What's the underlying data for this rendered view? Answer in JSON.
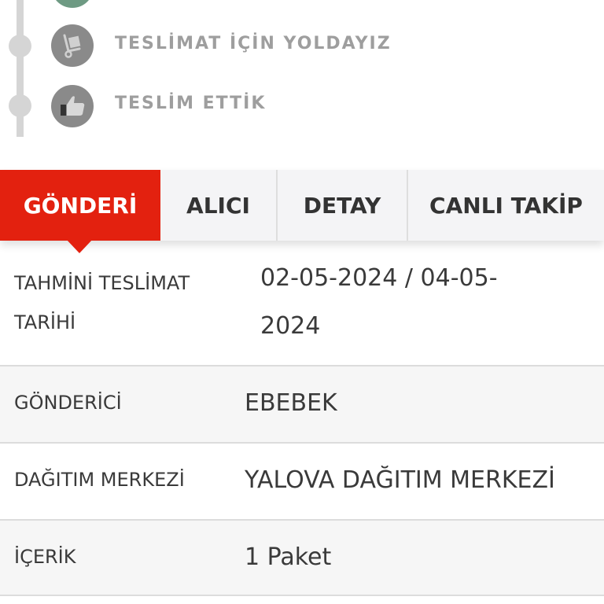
{
  "timeline": {
    "steps": [
      {
        "label": "",
        "icon": "status-check-icon"
      },
      {
        "label": "TESLİMAT İÇİN YOLDAYIZ",
        "icon": "hand-truck-icon"
      },
      {
        "label": "TESLİM ETTİK",
        "icon": "thumbs-up-icon"
      }
    ]
  },
  "tabs": [
    {
      "label": "GÖNDERİ",
      "active": true
    },
    {
      "label": "ALICI",
      "active": false
    },
    {
      "label": "DETAY",
      "active": false
    },
    {
      "label": "CANLI TAKİP",
      "active": false
    }
  ],
  "details": [
    {
      "label_line1": "TAHMİNİ TESLİMAT",
      "label_line2": "TARİHİ",
      "value_line1": "02-05-2024 / 04-05-",
      "value_line2": "2024"
    },
    {
      "label": "GÖNDERİCİ",
      "value": "EBEBEK"
    },
    {
      "label": "DAĞITIM MERKEZİ",
      "value": "YALOVA DAĞITIM MERKEZİ"
    },
    {
      "label": "İÇERİK",
      "value": "1 Paket"
    }
  ],
  "colors": {
    "accent": "#e3210f",
    "timeline_done": "#6e9a83",
    "timeline_pending": "#8a8a8a"
  }
}
